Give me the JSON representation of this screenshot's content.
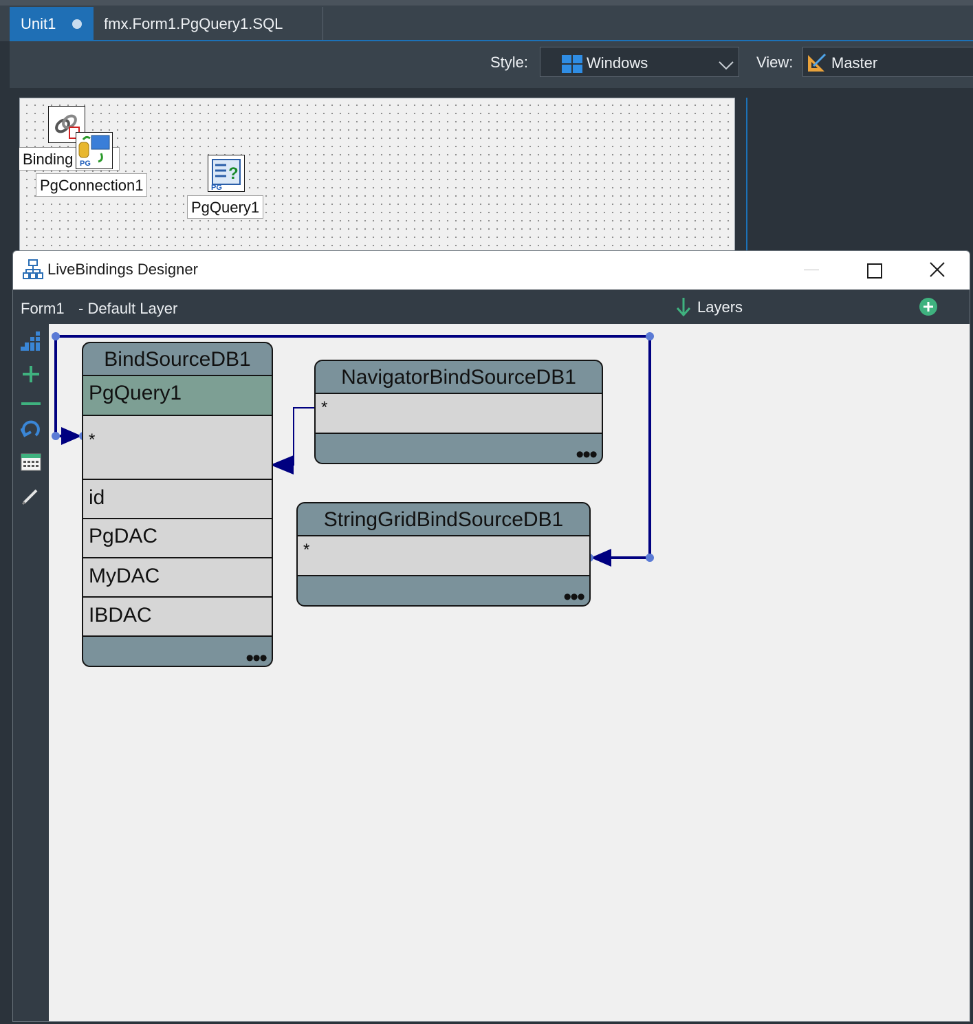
{
  "tabs": [
    {
      "label": "Unit1",
      "active": true,
      "modified": true
    },
    {
      "label": "fmx.Form1.PgQuery1.SQL",
      "active": false
    }
  ],
  "toolbar": {
    "style_label": "Style:",
    "style_value": "Windows",
    "view_label": "View:",
    "view_value": "Master"
  },
  "form": {
    "components": [
      {
        "label": "Binding",
        "icon": "binding-list-icon"
      },
      {
        "label": "PgConnection1",
        "icon": "pg-connection-icon"
      },
      {
        "label": "PgQuery1",
        "icon": "pg-query-icon"
      }
    ]
  },
  "livebindings": {
    "window_title": "LiveBindings Designer",
    "form_name": "Form1",
    "layer_name": "- Default Layer",
    "layers_label": "Layers",
    "sidebar_icons": [
      "arrange-icon",
      "add-icon",
      "remove-icon",
      "undo-icon",
      "grid-icon",
      "edit-icon"
    ],
    "sources": [
      {
        "title": "BindSourceDB1",
        "dataset": "PgQuery1",
        "fields": [
          "*",
          "id",
          "PgDAC",
          "MyDAC",
          "IBDAC"
        ]
      },
      {
        "title": "NavigatorBindSourceDB1",
        "fields": [
          "*"
        ]
      },
      {
        "title": "StringGridBindSourceDB1",
        "fields": [
          "*"
        ]
      }
    ],
    "more_label": "•••",
    "colors": {
      "link": "#000080",
      "selected_row": "#7d9f94",
      "box_header": "#7b929b",
      "box_row": "#d6d6d6"
    }
  }
}
